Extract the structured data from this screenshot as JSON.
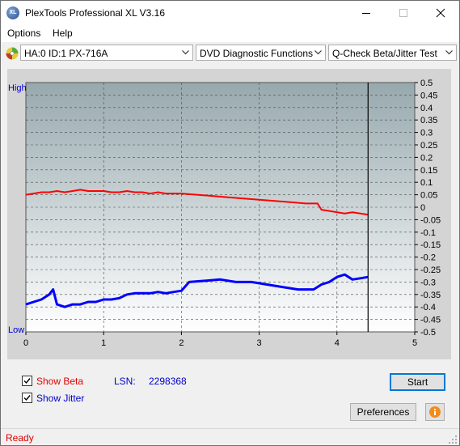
{
  "window": {
    "title": "PlexTools Professional XL V3.16",
    "app_icon_text": "XL"
  },
  "menu": {
    "options": "Options",
    "help": "Help"
  },
  "toolbar": {
    "drive": "HA:0 ID:1  PX-716A",
    "function": "DVD Diagnostic Functions",
    "test": "Q-Check Beta/Jitter Test"
  },
  "chart_data": {
    "type": "line",
    "left_axis_labels": {
      "top": "High",
      "bottom": "Low"
    },
    "x_ticks": [
      "0",
      "1",
      "2",
      "3",
      "4",
      "5"
    ],
    "xlim": [
      0,
      5
    ],
    "y_right_ticks": [
      "0.5",
      "0.45",
      "0.4",
      "0.35",
      "0.3",
      "0.25",
      "0.2",
      "0.15",
      "0.1",
      "0.05",
      "0",
      "-0.05",
      "-0.1",
      "-0.15",
      "-0.2",
      "-0.25",
      "-0.3",
      "-0.35",
      "-0.4",
      "-0.45",
      "-0.5"
    ],
    "ylim": [
      -0.5,
      0.5
    ],
    "grid": true,
    "cursor_x": 4.4,
    "series": [
      {
        "key": "beta",
        "color": "#ff0000",
        "x": [
          0,
          0.1,
          0.2,
          0.3,
          0.4,
          0.5,
          0.6,
          0.7,
          0.8,
          0.9,
          1.0,
          1.1,
          1.2,
          1.3,
          1.4,
          1.5,
          1.6,
          1.7,
          1.8,
          1.9,
          2.0,
          2.2,
          2.4,
          2.6,
          2.8,
          3.0,
          3.2,
          3.4,
          3.6,
          3.75,
          3.8,
          3.9,
          4.0,
          4.1,
          4.2,
          4.3,
          4.4
        ],
        "y": [
          0.05,
          0.055,
          0.06,
          0.06,
          0.065,
          0.06,
          0.065,
          0.07,
          0.065,
          0.065,
          0.065,
          0.06,
          0.06,
          0.065,
          0.06,
          0.06,
          0.055,
          0.06,
          0.055,
          0.055,
          0.055,
          0.05,
          0.045,
          0.04,
          0.035,
          0.03,
          0.025,
          0.02,
          0.015,
          0.015,
          -0.01,
          -0.015,
          -0.02,
          -0.025,
          -0.02,
          -0.025,
          -0.03
        ]
      },
      {
        "key": "jitter",
        "color": "#0000ff",
        "x": [
          0,
          0.1,
          0.2,
          0.3,
          0.35,
          0.4,
          0.5,
          0.6,
          0.7,
          0.8,
          0.9,
          1.0,
          1.1,
          1.2,
          1.3,
          1.4,
          1.5,
          1.6,
          1.7,
          1.8,
          1.9,
          2.0,
          2.1,
          2.3,
          2.5,
          2.7,
          2.9,
          3.1,
          3.3,
          3.5,
          3.7,
          3.8,
          3.9,
          4.0,
          4.1,
          4.2,
          4.3,
          4.4
        ],
        "y": [
          -0.39,
          -0.38,
          -0.37,
          -0.35,
          -0.33,
          -0.39,
          -0.4,
          -0.39,
          -0.39,
          -0.38,
          -0.38,
          -0.37,
          -0.37,
          -0.365,
          -0.35,
          -0.345,
          -0.345,
          -0.345,
          -0.34,
          -0.345,
          -0.34,
          -0.335,
          -0.3,
          -0.295,
          -0.29,
          -0.3,
          -0.3,
          -0.31,
          -0.32,
          -0.33,
          -0.33,
          -0.31,
          -0.3,
          -0.28,
          -0.27,
          -0.29,
          -0.285,
          -0.28
        ]
      }
    ]
  },
  "controls": {
    "show_beta": "Show Beta",
    "show_jitter": "Show Jitter",
    "lsn_label": "LSN:",
    "lsn_value": "2298368",
    "start": "Start",
    "preferences": "Preferences"
  },
  "status": {
    "text": "Ready"
  }
}
